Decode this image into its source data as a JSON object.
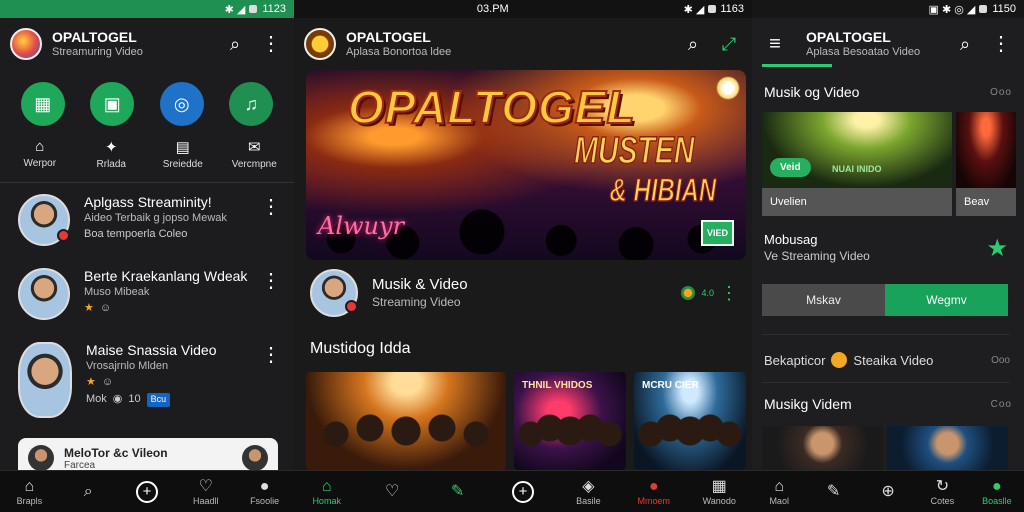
{
  "panel1": {
    "status_time": "1123",
    "app_title": "OPALTOGEL",
    "app_subtitle": "Streamuring Video",
    "categories": [
      {
        "icon": "film-icon",
        "color": "#1fa85a"
      },
      {
        "icon": "tv-icon",
        "color": "#1fa85a"
      },
      {
        "icon": "compass-icon",
        "color": "#1e73c8"
      },
      {
        "icon": "music-icon",
        "color": "#1f8f52"
      }
    ],
    "quick": [
      {
        "icon": "home-icon",
        "label": "Werpor"
      },
      {
        "icon": "star-icon",
        "label": "Rrlada"
      },
      {
        "icon": "chat-icon",
        "label": "Sreiedde"
      },
      {
        "icon": "mail-icon",
        "label": "Vercmpne"
      }
    ],
    "items": [
      {
        "title": "Aplgass Streaminity!",
        "sub": "Aideo Terbaik g jopso Mewak",
        "meta": "Boa tempoerla Coleo"
      },
      {
        "title": "Berte Kraekanlang Wdeak",
        "sub": "Muso Mibeak",
        "meta": ""
      },
      {
        "title": "Maise Snassia Video",
        "sub": "Vrosajrnlo Mlden",
        "meta": "Mok",
        "meta2": "10",
        "chip": "Bcu"
      }
    ],
    "mini_card": {
      "title": "MeloTor &c Vileon",
      "sub": "Farcea"
    },
    "nav": [
      {
        "icon": "home-icon",
        "label": "Brapls"
      },
      {
        "icon": "search-icon",
        "label": ""
      },
      {
        "icon": "add-icon",
        "label": ""
      },
      {
        "icon": "heart-icon",
        "label": "Haadll"
      },
      {
        "icon": "person-icon",
        "label": "Fsoolie"
      }
    ]
  },
  "panel2": {
    "status_time": "03.PM",
    "app_title": "OPALTOGEL",
    "app_subtitle": "Aplasa Bonortoa ldee",
    "hero": {
      "title": "OPALTOGEL",
      "line2": "MUSTEN",
      "line3": "& HIBIAN",
      "script": "Alwuyr",
      "badge": "VIED"
    },
    "channel": {
      "title": "Musik & Video",
      "sub": "Streaming Video",
      "stat": "4.0"
    },
    "section_title": "Mustidog Idda",
    "thumbs": [
      {
        "label": ""
      },
      {
        "label": "THNIL VHIDOS"
      },
      {
        "label": "MCRU CIER"
      }
    ],
    "nav": [
      {
        "icon": "home-icon",
        "label": "Homak"
      },
      {
        "icon": "heart-icon",
        "label": ""
      },
      {
        "icon": "pen-icon",
        "label": ""
      },
      {
        "icon": "add-icon",
        "label": ""
      },
      {
        "icon": "shield-icon",
        "label": "Basile"
      },
      {
        "icon": "record-icon",
        "label": "Mmoem"
      },
      {
        "icon": "calendar-icon",
        "label": "Wanodo"
      }
    ]
  },
  "panel3": {
    "status_time": "1150",
    "app_title": "OPALTOGEL",
    "app_subtitle": "Aplasa Besoatao Video",
    "section1": "Musik og Video",
    "section1_more": "Ooo",
    "cards": [
      {
        "caption": "Uvelien",
        "pill": "Veid",
        "pill_text": "NUAI INIDO"
      },
      {
        "caption": "Beav"
      }
    ],
    "info_title": "Mobusag",
    "info_sub": "Ve Streaming Video",
    "seg": [
      "Mskav",
      "Wegmv"
    ],
    "row_label": "Bekapticor",
    "row_value": "Steaika Video",
    "row_more": "Ooo",
    "section2": "Musikg Videm",
    "section2_more": "Coo",
    "nav": [
      {
        "icon": "home-icon",
        "label": "Maol"
      },
      {
        "icon": "pen-icon",
        "label": ""
      },
      {
        "icon": "globe-icon",
        "label": ""
      },
      {
        "icon": "refresh-icon",
        "label": "Cotes"
      },
      {
        "icon": "person-icon",
        "label": "Boaslle"
      }
    ]
  },
  "colors": {
    "accent": "#2ecc71",
    "status_green": "#1f8f52",
    "danger": "#e53935"
  }
}
